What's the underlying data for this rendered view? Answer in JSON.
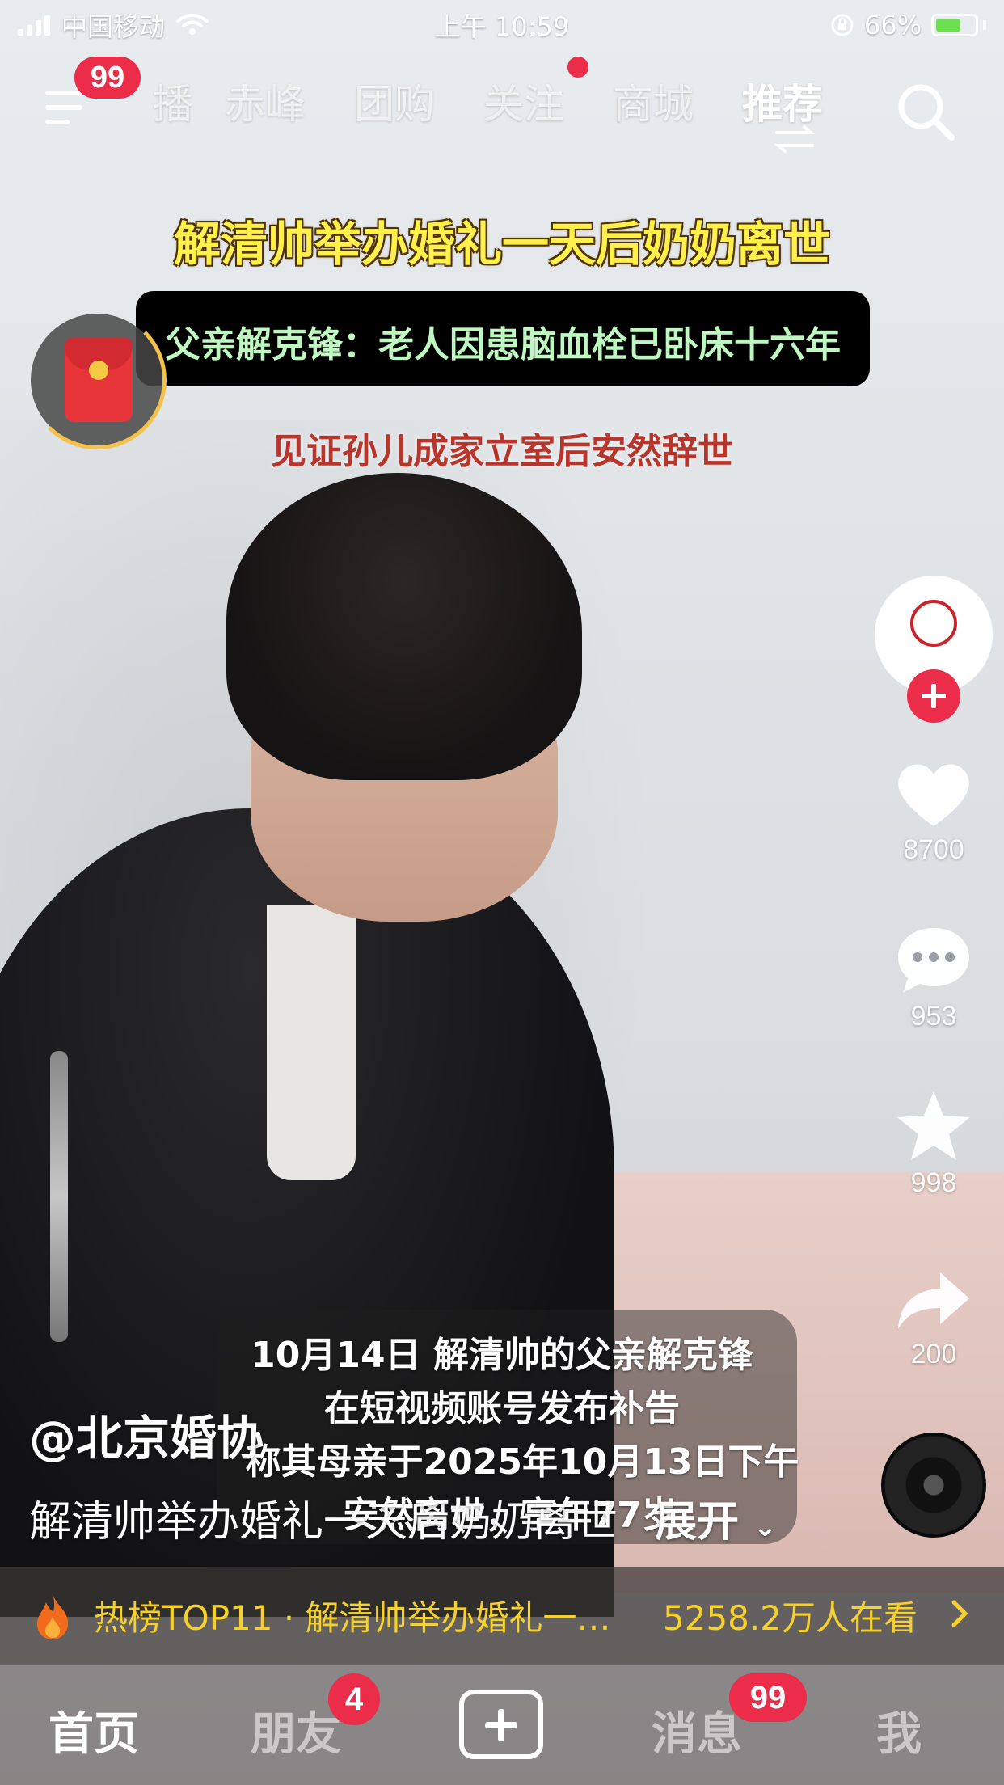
{
  "status_bar": {
    "carrier": "中国移动",
    "time": "上午 10:59",
    "battery_percent": "66%",
    "battery_level": 0.66,
    "icons": [
      "signal-icon",
      "wifi-icon",
      "lock-rotation-icon",
      "battery-icon"
    ]
  },
  "top_nav": {
    "menu_badge": "99",
    "tabs": [
      "播",
      "赤峰",
      "团购",
      "关注",
      "商城",
      "推荐"
    ],
    "active_tab": "推荐",
    "icons": [
      "menu-icon",
      "search-icon",
      "swap-icon"
    ]
  },
  "video": {
    "caption_title": "解清帅举办婚礼一天后奶奶离世",
    "caption_line2": "父亲解克锋：老人因患脑血栓已卧床十六年",
    "caption_line3": "见证孙儿成家立室后安然辞世",
    "subtitles": [
      "10月14日   解清帅的父亲解克锋",
      "在短视频账号发布补告",
      "称其母亲于2025年10月13日下午",
      "安然离世，享年77岁"
    ]
  },
  "right_rail": {
    "likes": "8700",
    "comments": "953",
    "favorites": "998",
    "shares": "200",
    "icons": [
      "avatar",
      "follow-icon",
      "heart-icon",
      "comment-icon",
      "star-icon",
      "share-icon",
      "music-disc-icon"
    ]
  },
  "post": {
    "author": "@北京婚协",
    "description": "解清帅举办婚礼一天后奶奶离世",
    "expand_label": "展开"
  },
  "hot_bar": {
    "label": "热榜TOP11 · 解清帅举办婚礼一…",
    "views": "5258.2万人在看"
  },
  "bottom_nav": {
    "items": [
      "首页",
      "朋友",
      "消息",
      "我"
    ],
    "active": "首页",
    "friends_badge": "4",
    "messages_badge": "99"
  },
  "colors": {
    "accent_red": "#ec2d4a",
    "hot_yellow": "#f5d12a",
    "caption_yellow": "#fff04b"
  }
}
